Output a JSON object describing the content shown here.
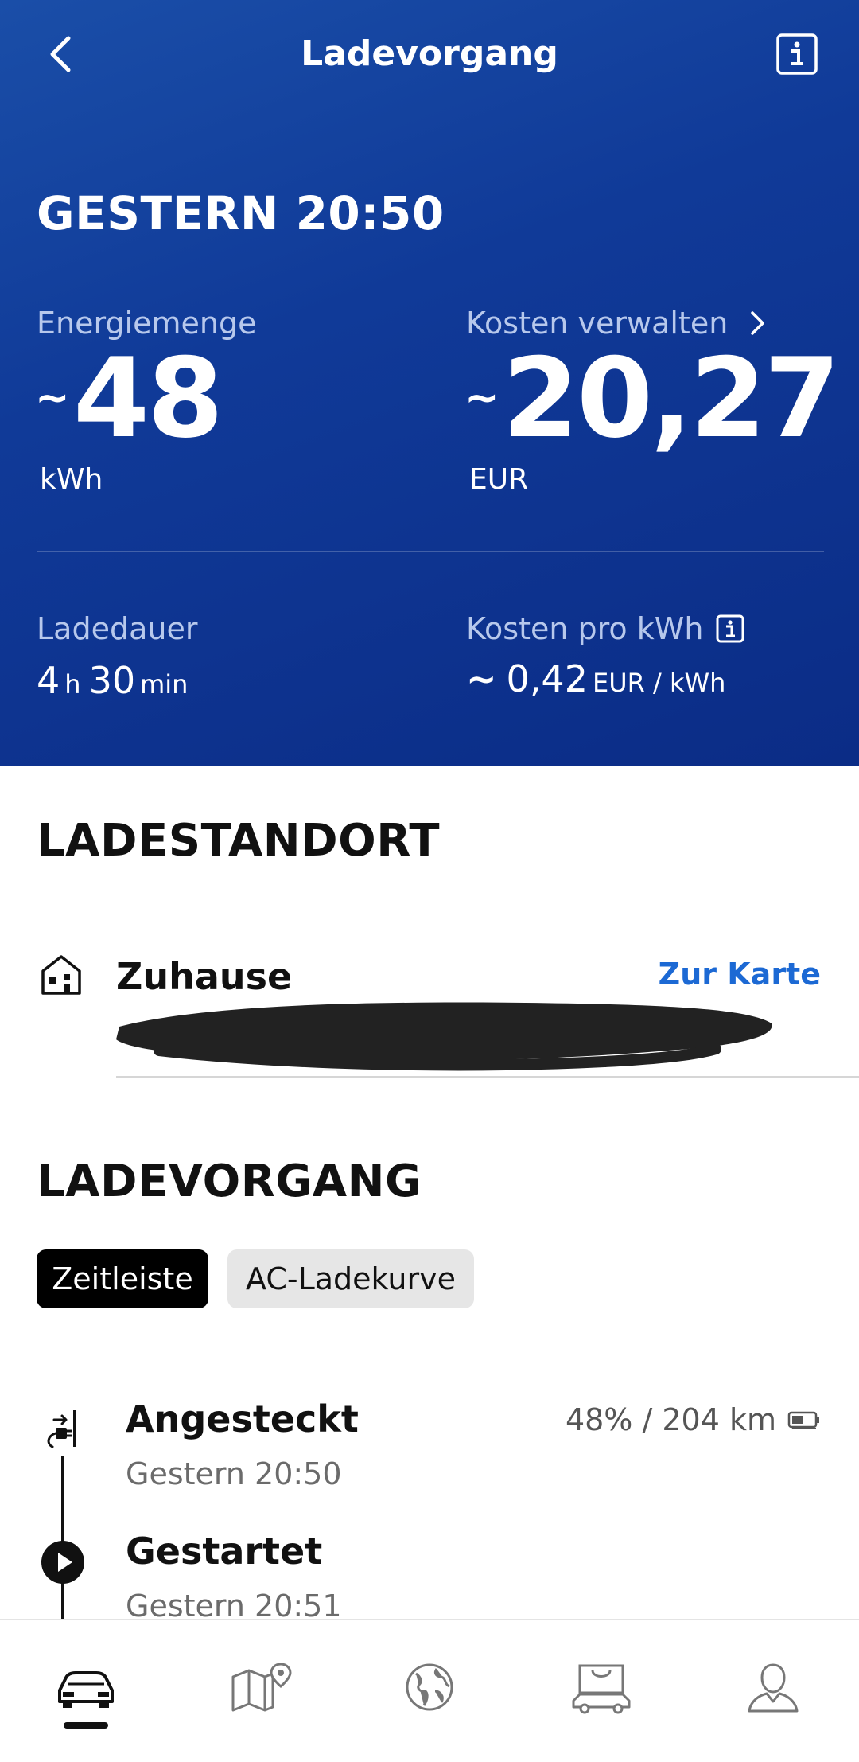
{
  "header": {
    "title": "Ladevorgang",
    "date": "GESTERN 20:50"
  },
  "energy": {
    "label": "Energiemenge",
    "approx": "~",
    "value": "48",
    "unit": "kWh"
  },
  "cost": {
    "label": "Kosten verwalten",
    "approx": "~",
    "value": "20,27",
    "unit": "EUR"
  },
  "duration": {
    "label": "Ladedauer",
    "hours": "4",
    "hours_unit": "h",
    "minutes": "30",
    "minutes_unit": "min"
  },
  "cost_per_kwh": {
    "label": "Kosten pro kWh",
    "approx": "~",
    "value": "0,42",
    "unit": "EUR / kWh"
  },
  "location": {
    "section_title": "LADESTANDORT",
    "name": "Zuhause",
    "map_link": "Zur Karte"
  },
  "session": {
    "section_title": "LADEVORGANG",
    "tabs": [
      {
        "label": "Zeitleiste",
        "active": true
      },
      {
        "label": "AC-Ladekurve",
        "active": false
      }
    ],
    "timeline": [
      {
        "title": "Angesteckt",
        "time": "Gestern 20:50",
        "battery": "48% / 204 km"
      },
      {
        "title": "Gestartet",
        "time": "Gestern 20:51"
      }
    ]
  },
  "nav": {
    "items": [
      "car-icon",
      "map-pin-icon",
      "globe-icon",
      "shop-icon",
      "profile-icon"
    ]
  },
  "colors": {
    "accent_link": "#1c69d4",
    "hero_blue": "#103a98"
  }
}
